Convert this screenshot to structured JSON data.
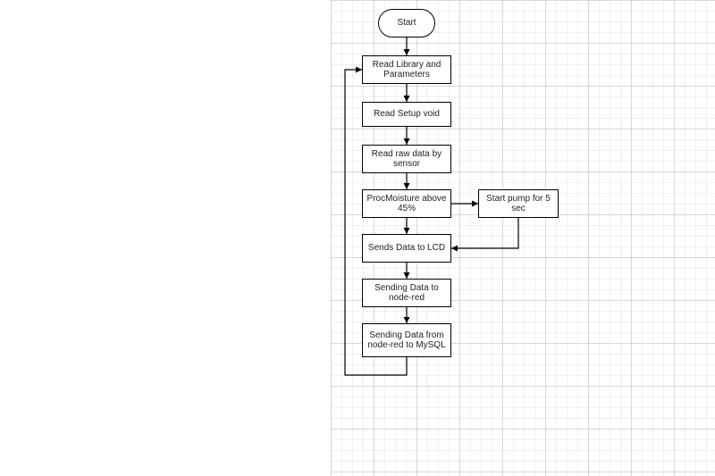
{
  "nodes": {
    "start": {
      "label": "Start"
    },
    "read_lib": {
      "label": "Read Library and Parameters"
    },
    "read_setup": {
      "label": "Read Setup void"
    },
    "read_raw": {
      "label": "Read raw data by sensor"
    },
    "proc_moist": {
      "label": "ProcMoisture above 45%"
    },
    "start_pump": {
      "label": "Start pump for 5 sec"
    },
    "sends_lcd": {
      "label": "Sends Data to LCD"
    },
    "send_nodered": {
      "label": "Sending Data to node-red"
    },
    "send_mysql": {
      "label": "Sending Data from node-red to MySQL"
    }
  }
}
